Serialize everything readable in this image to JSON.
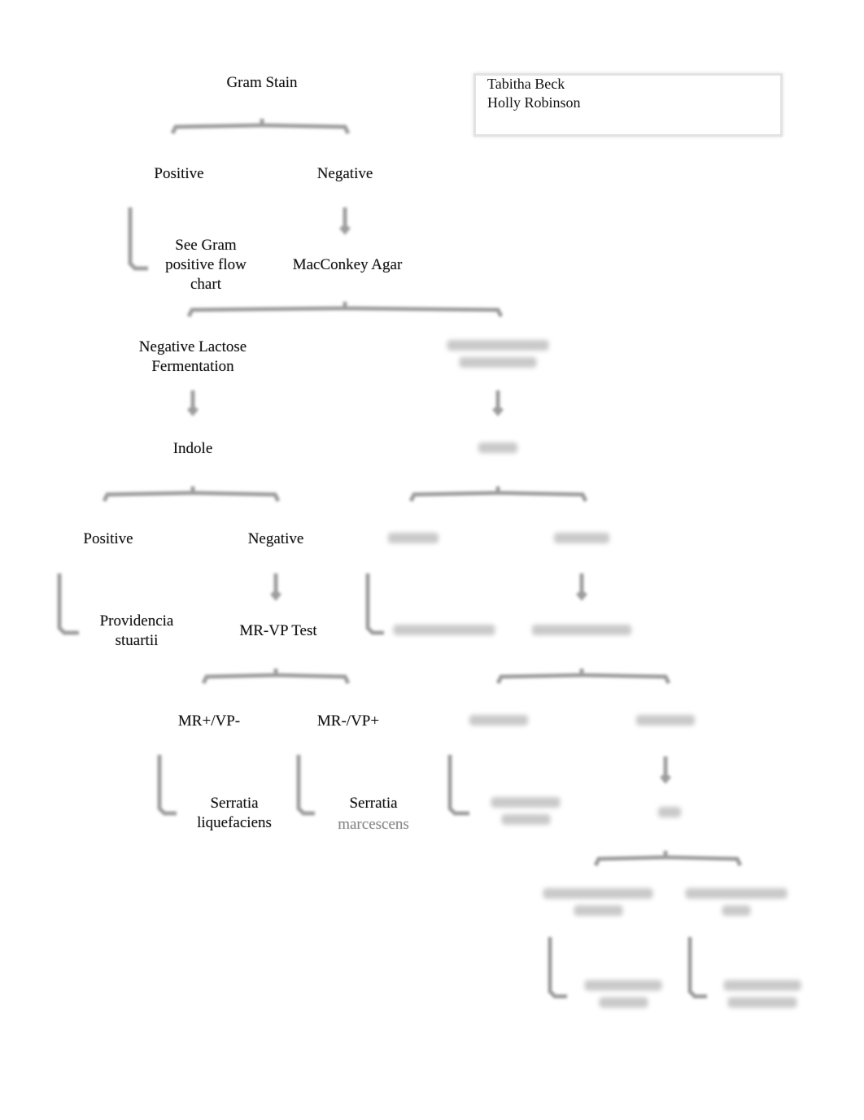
{
  "authors": [
    "Tabitha Beck",
    "Holly Robinson"
  ],
  "nodes": {
    "gram_stain": [
      "Gram Stain"
    ],
    "gram_positive": [
      "Positive"
    ],
    "gram_negative": [
      "Negative"
    ],
    "see_gram_positive": [
      "See Gram",
      "positive flow",
      "chart"
    ],
    "macconkey": [
      "MacConkey Agar"
    ],
    "neg_lactose": [
      "Negative Lactose",
      "Fermentation"
    ],
    "indole": [
      "Indole"
    ],
    "indole_positive": [
      "Positive"
    ],
    "indole_negative": [
      "Negative"
    ],
    "providencia": [
      "Providencia",
      "stuartii"
    ],
    "mrvp": [
      "MR-VP Test"
    ],
    "mr_pos_vp_neg": [
      "MR+/VP-"
    ],
    "mr_neg_vp_pos": [
      "MR-/VP+"
    ],
    "serratia_liq": [
      "Serratia",
      "liquefaciens"
    ],
    "serratia_mar": [
      "Serratia",
      "marcescens"
    ]
  }
}
